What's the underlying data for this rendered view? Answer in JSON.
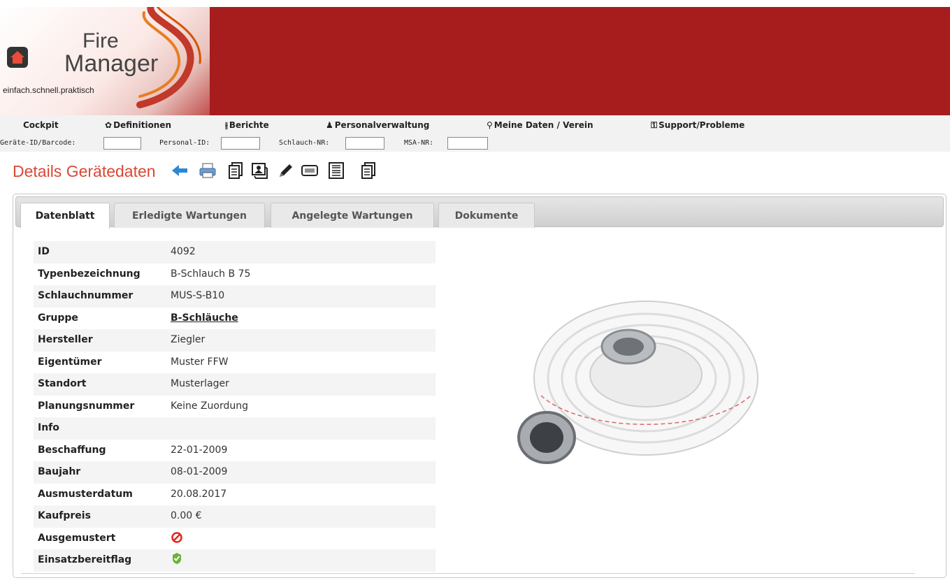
{
  "header": {
    "logo_line1": "Fire",
    "logo_line2": "Manager",
    "tagline": "einfach.schnell.praktisch"
  },
  "nav": {
    "menu": [
      {
        "label": "Cockpit",
        "icon": ""
      },
      {
        "label": "Definitionen",
        "icon": "gear-icon"
      },
      {
        "label": "Berichte",
        "icon": "sliders-icon"
      },
      {
        "label": "Personalverwaltung",
        "icon": "person-icon"
      },
      {
        "label": "Meine Daten / Verein",
        "icon": "wrench-icon"
      },
      {
        "label": "Support/Probleme",
        "icon": "support-icon"
      }
    ],
    "search": [
      {
        "label": "Geräte-ID/Barcode:",
        "value": ""
      },
      {
        "label": "Personal-ID:",
        "value": ""
      },
      {
        "label": "Schlauch-NR:",
        "value": ""
      },
      {
        "label": "MSA-NR:",
        "value": ""
      }
    ]
  },
  "page": {
    "title": "Details Gerätedaten",
    "toolbar_icons": [
      "back-arrow-icon",
      "print-icon",
      "copy-icon",
      "photo-icon",
      "edit-pencil-icon",
      "barcode-icon",
      "barcode-sheet-icon",
      "copy-icon"
    ]
  },
  "tabs": [
    {
      "label": "Datenblatt",
      "active": true
    },
    {
      "label": "Erledigte Wartungen",
      "active": false
    },
    {
      "label": "Angelegte Wartungen",
      "active": false
    },
    {
      "label": "Dokumente",
      "active": false
    }
  ],
  "details": [
    {
      "key": "ID",
      "value": "4092"
    },
    {
      "key": "Typenbezeichnung",
      "value": "B-Schlauch B 75"
    },
    {
      "key": "Schlauchnummer",
      "value": "MUS-S-B10"
    },
    {
      "key": "Gruppe",
      "value": "B-Schläuche",
      "link": true
    },
    {
      "key": "Hersteller",
      "value": "Ziegler"
    },
    {
      "key": "Eigentümer",
      "value": "Muster FFW"
    },
    {
      "key": "Standort",
      "value": "Musterlager"
    },
    {
      "key": "Planungsnummer",
      "value": "Keine Zuordung"
    },
    {
      "key": "Info",
      "value": ""
    },
    {
      "key": "Beschaffung",
      "value": "22-01-2009"
    },
    {
      "key": "Baujahr",
      "value": "08-01-2009"
    },
    {
      "key": "Ausmusterdatum",
      "value": "20.08.2017"
    },
    {
      "key": "Kaufpreis",
      "value": "0.00 €"
    },
    {
      "key": "Ausgemustert",
      "icon": "red-no-icon"
    },
    {
      "key": "Einsatzbereitflag",
      "icon": "green-check-icon"
    }
  ],
  "colors": {
    "banner": "#a71d1d",
    "title": "#d94836"
  }
}
